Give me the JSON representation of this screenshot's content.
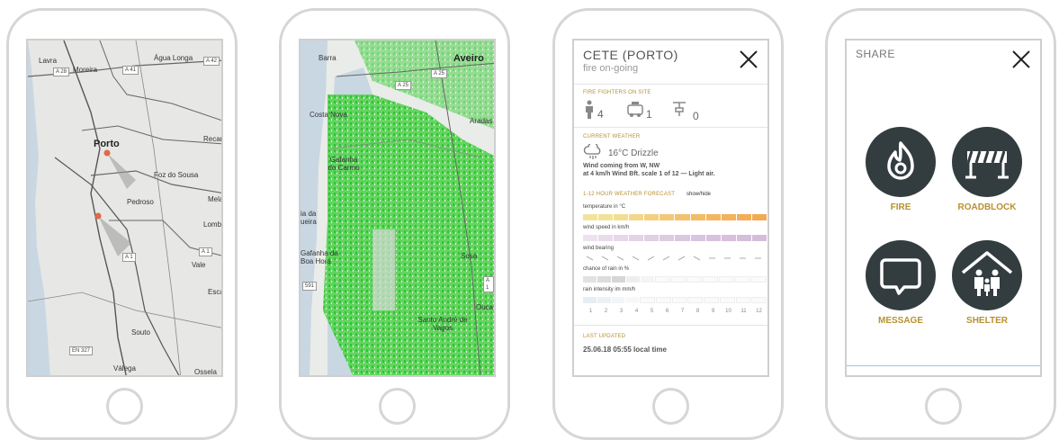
{
  "map_porto": {
    "labels": [
      "Lavra",
      "Água Longa",
      "Moreira",
      "Porto",
      "Recarei",
      "Foz do Sousa",
      "Pedroso",
      "Mela",
      "Lomba",
      "Vale",
      "Esca",
      "Souto",
      "Válega",
      "Ossela"
    ],
    "shields": [
      "A 28",
      "A 41",
      "A 42",
      "A 1",
      "A 1",
      "EN 327"
    ]
  },
  "map_aveiro": {
    "labels": [
      "Barra",
      "Aveiro",
      "Costa Nova",
      "Aradas",
      "Gafanha do Carmo",
      "ia da ueira",
      "Gafanha da Boa Hora",
      "Sosa",
      "Ouca",
      "Santo André de Vagos"
    ],
    "shields": [
      "A 25",
      "A 25",
      "A 1",
      "591"
    ]
  },
  "details": {
    "title": "CETE (PORTO)",
    "status": "fire on-going",
    "firefighters_header": "FIRE FIGHTERS ON SITE",
    "counts": [
      "4",
      "1",
      "0"
    ],
    "weather_header": "CURRENT WEATHER",
    "weather_summary": "16°C Drizzle",
    "wind_line1": "Wind coming from W, NW",
    "wind_line2": "at 4 km/h Wind Bft. scale 1 of 12 — Light air.",
    "forecast_header": "1-12 HOUR WEATHER FORECAST",
    "forecast_toggle": "show/hide",
    "rows": [
      "temperature in °C",
      "wind speed in km/h",
      "wind bearing",
      "chance of rain in %",
      "rain intensity im mm/h"
    ],
    "hours": [
      "1",
      "2",
      "3",
      "4",
      "5",
      "6",
      "7",
      "8",
      "9",
      "10",
      "11",
      "12"
    ],
    "updated_header": "LAST UPDATED",
    "updated_value": "25.06.18 05:55 local time",
    "colors": {
      "accent": "#b8912f",
      "temp": "#f3c057",
      "wind": "#dcc8e0"
    }
  },
  "share": {
    "title": "SHARE",
    "options": [
      "FIRE",
      "ROADBLOCK",
      "MESSAGE",
      "SHELTER"
    ],
    "colors": {
      "circle": "#333d40",
      "label": "#b8912f"
    }
  }
}
